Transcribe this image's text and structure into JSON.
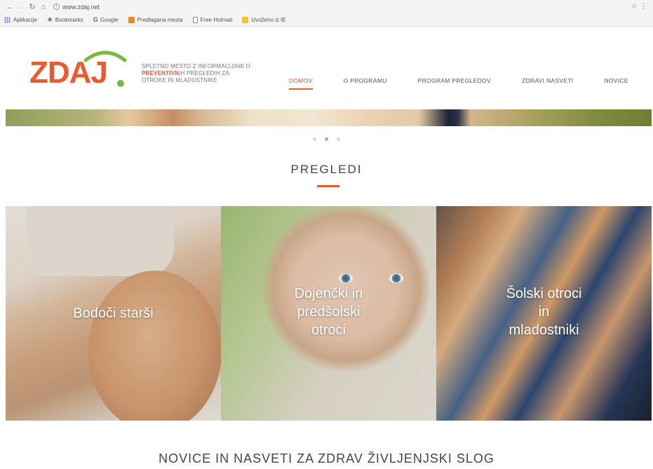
{
  "browser": {
    "back_icon": "back-arrow-icon",
    "forward_icon": "forward-arrow-icon",
    "url": "www.zdaj.net",
    "bookmarks": [
      {
        "label": "Aplikacije",
        "icon": "apps-grid-icon"
      },
      {
        "label": "Bookmarks",
        "icon": "star-icon"
      },
      {
        "label": "Google",
        "icon": "google-icon"
      },
      {
        "label": "Predlagana mesta",
        "icon": "suggested-sites-icon"
      },
      {
        "label": "Free Hotmail",
        "icon": "page-icon"
      },
      {
        "label": "Uvoženo iz IE",
        "icon": "folder-icon"
      }
    ]
  },
  "site": {
    "logo_text": "ZDAJ",
    "brand_colors": {
      "orange": "#ea5a2e",
      "green": "#7bb841"
    },
    "tagline_line1": "SPLETNO MESTO Z INFORMACIJAMI O",
    "tagline_strong": "PREVENTIVN",
    "tagline_line2_rest": "IH PREGLEDIH ZA",
    "tagline_line3": "OTROKE IN MLADOSTNIKE",
    "nav": [
      {
        "label": "DOMOV",
        "active": true
      },
      {
        "label": "O PROGRAMU",
        "active": false
      },
      {
        "label": "PROGRAM PREGLEDOV",
        "active": false
      },
      {
        "label": "ZDRAVI NASVETI",
        "active": false
      },
      {
        "label": "NOVICE",
        "active": false
      }
    ]
  },
  "slider": {
    "dots": 3,
    "active_index": 1
  },
  "section": {
    "title": "PREGLEDI",
    "tiles": [
      {
        "label_lines": [
          "Bodoči starši"
        ]
      },
      {
        "label_lines": [
          "Dojenčki in",
          "predšolski",
          "otroci"
        ]
      },
      {
        "label_lines": [
          "Šolski otroci",
          "in",
          "mladostniki"
        ]
      }
    ]
  },
  "news": {
    "title": "NOVICE IN NASVETI ZA ZDRAV ŽIVLJENJSKI SLOG"
  }
}
